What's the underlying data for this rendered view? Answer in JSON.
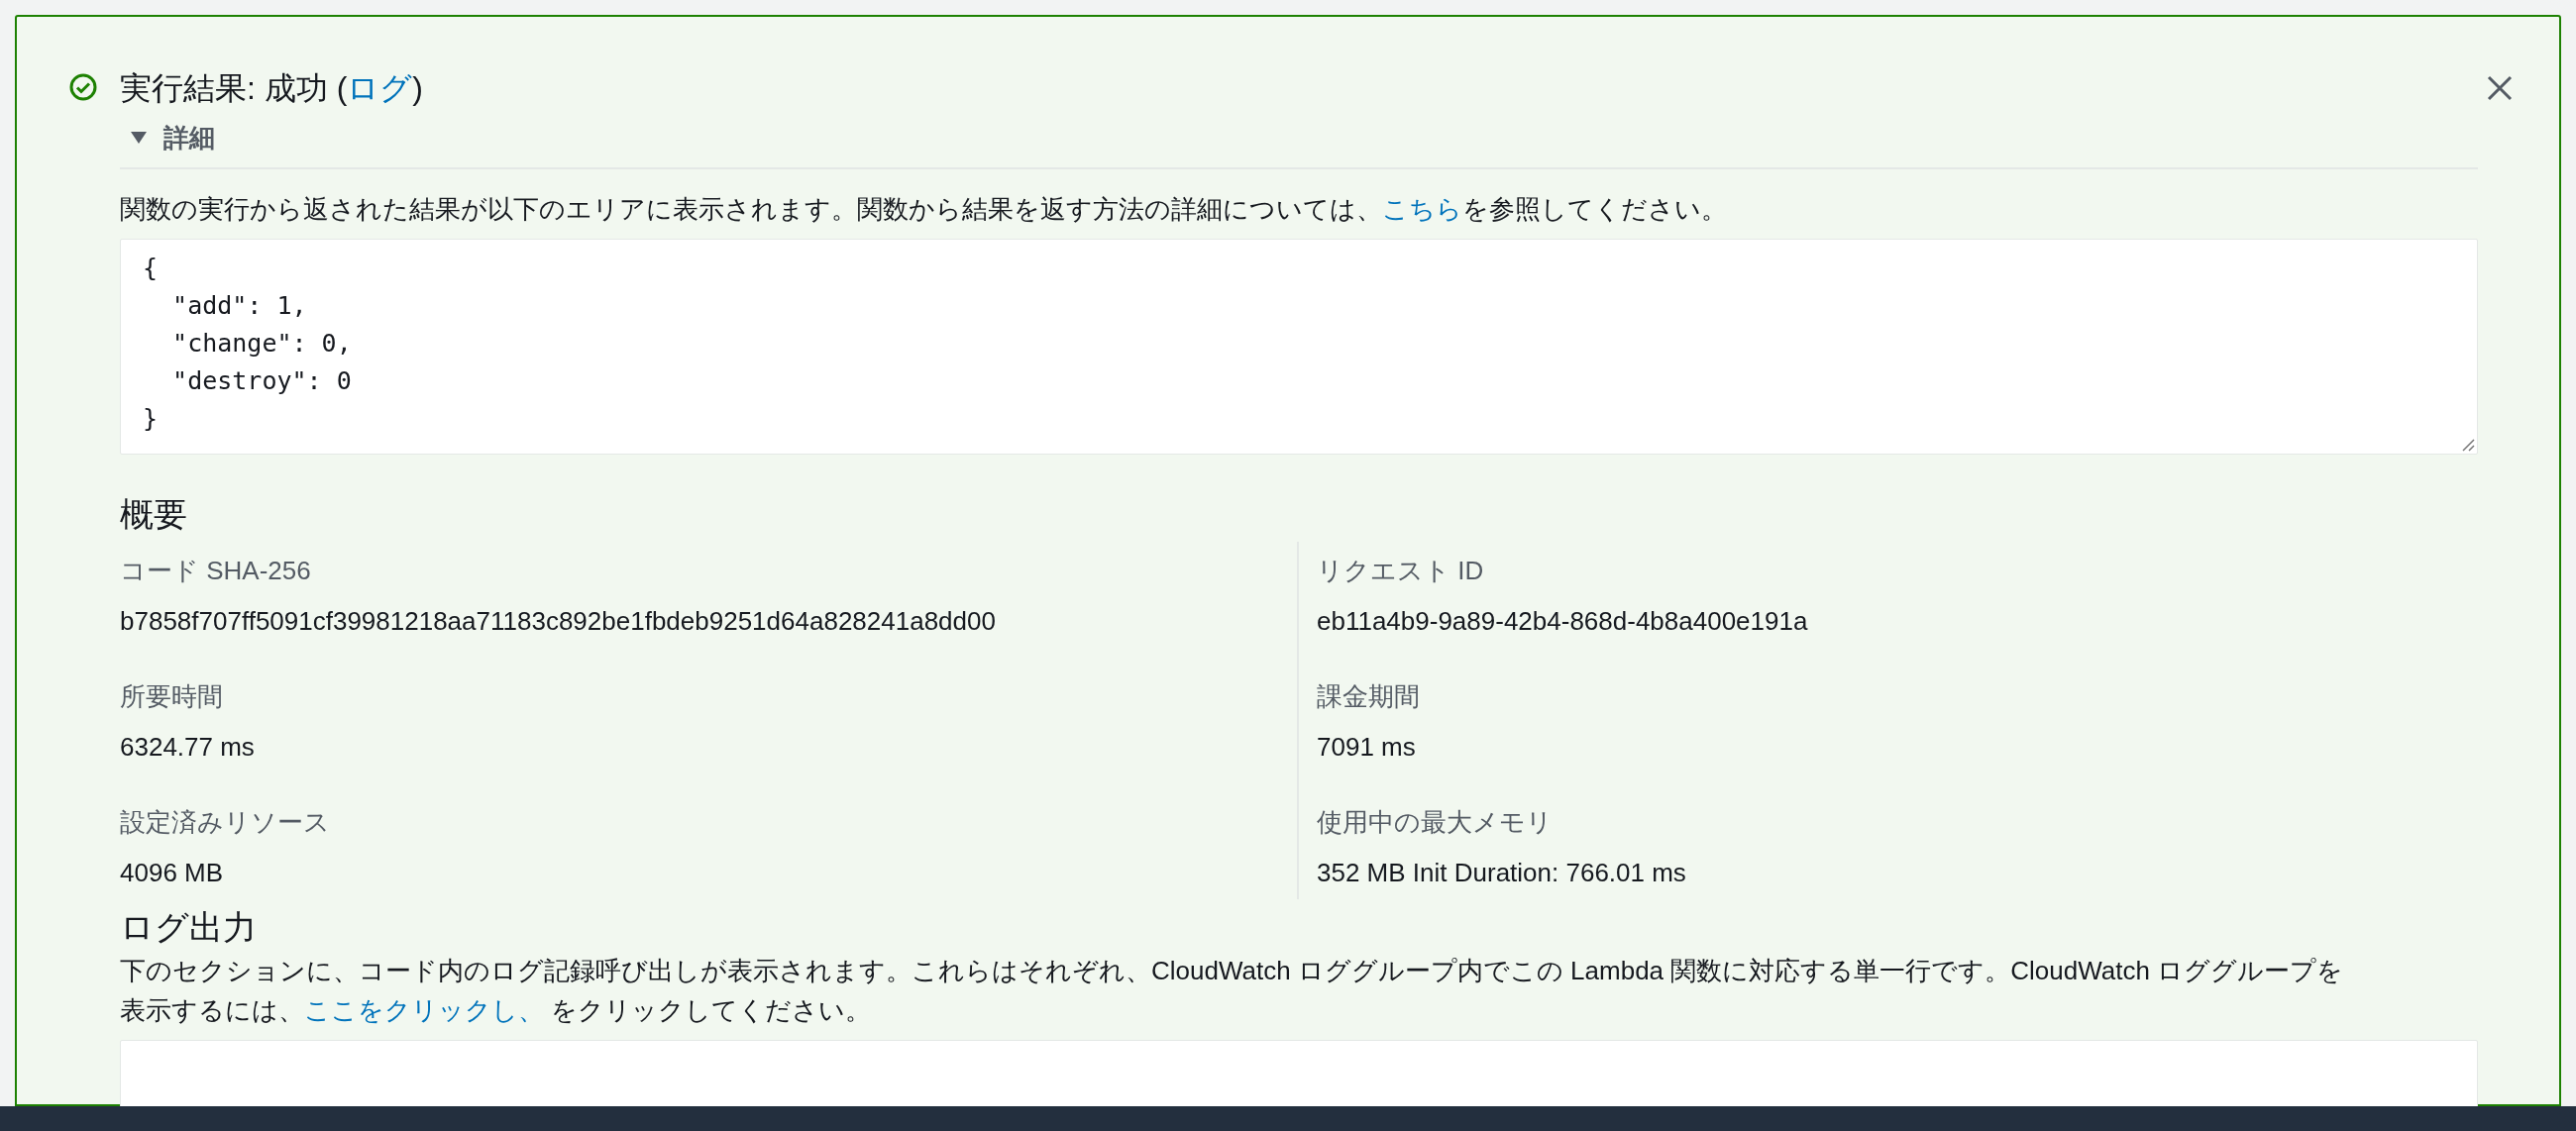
{
  "result": {
    "success": true,
    "title": "実行結果: 成功 (",
    "log_link": "ログ",
    "title_end": ")"
  },
  "details": {
    "label": "詳細",
    "expanded": true,
    "description": {
      "before": "関数の実行から返された結果が以下のエリアに表示されます。関数から結果を返す方法の詳細については、",
      "link": "こちら",
      "after": "を参照してください。"
    },
    "output_lines": [
      "{",
      "  \"add\": 1,",
      "  \"change\": 0,",
      "  \"destroy\": 0",
      "}"
    ]
  },
  "summary": {
    "heading": "概要",
    "columns": [
      [
        {
          "label": "コード SHA-256",
          "value": "b7858f707ff5091cf39981218aa71183c892be1fbdeb9251d64a828241a8dd00"
        },
        {
          "label": "所要時間",
          "value": "6324.77 ms"
        },
        {
          "label": "設定済みリソース",
          "value": "4096 MB"
        }
      ],
      [
        {
          "label": "リクエスト ID",
          "value": "eb11a4b9-9a89-42b4-868d-4b8a400e191a"
        },
        {
          "label": "課金期間",
          "value": "7091 ms"
        },
        {
          "label": "使用中の最大メモリ",
          "value": "352 MB Init Duration: 766.01 ms"
        }
      ]
    ]
  },
  "log_output": {
    "heading": "ログ出力",
    "line1": "下のセクションに、コード内のログ記録呼び出しが表示されます。これらはそれぞれ、CloudWatch ロググループ内でこの Lambda 関数に対応する単一行です。CloudWatch ロググループを",
    "line2_before": "表示するには、",
    "link": "ここをクリックし、",
    "line2_after": " をクリックしてください。"
  }
}
